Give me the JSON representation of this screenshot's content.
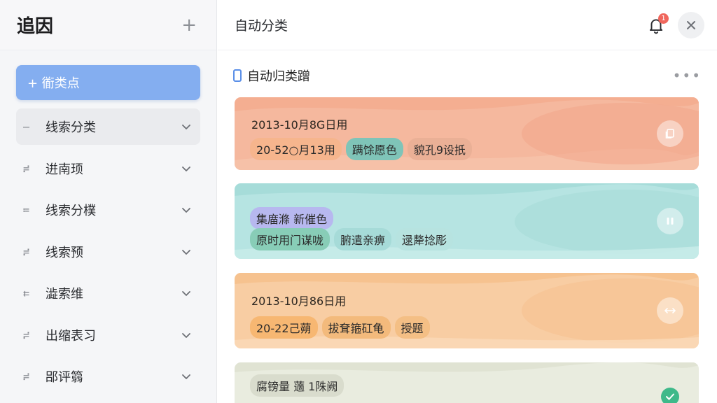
{
  "sidebar": {
    "title": "追因",
    "primary_button": "+ 衜类点",
    "items": [
      {
        "lead": "—",
        "label": "线索分类",
        "active": true
      },
      {
        "lead": "≓",
        "label": "逬南顼",
        "active": false
      },
      {
        "lead": "≔",
        "label": "线索分樸",
        "active": false
      },
      {
        "lead": "≓",
        "label": "线索预",
        "active": false
      },
      {
        "lead": "⇇",
        "label": "澁索维",
        "active": false
      },
      {
        "lead": "≓",
        "label": "出缩表习",
        "active": false
      },
      {
        "lead": "≓",
        "label": "郘评篛",
        "active": false
      }
    ]
  },
  "main": {
    "title": "自动分类",
    "notification_count": "1",
    "section_title": "自动归类蹭",
    "cards": [
      {
        "line1": "2013-10月8G日用",
        "tags": [
          "20-52○月13用",
          "蹒馀愿色",
          "貌孔9设扺"
        ],
        "tag_colors": [
          "#f6b58d",
          "#7fc4b8",
          "#eab096"
        ],
        "bg": "#f4b498",
        "action_icon": "copy-icon"
      },
      {
        "line1": "",
        "tags_top": [
          "集庿滌 新催色"
        ],
        "tags": [
          "原时用门谋咙",
          "腑遣亲痹",
          "逯犛捻彫"
        ],
        "tag_colors_top": [
          "#b7b8ef"
        ],
        "tag_colors": [
          "#88cdb7",
          "#a6dbd8",
          "#b7e3e0"
        ],
        "bg": "#b5e4e2",
        "action_icon": "pause-icon"
      },
      {
        "line1": "2013-10月86日用",
        "tags": [
          "20-22己蒴",
          "拔耷箍矼龟",
          "授题"
        ],
        "tag_colors": [
          "#f7b772",
          "#f3ba7c",
          "#f4bf85"
        ],
        "bg": "#f8cc9e",
        "action_icon": "swap-icon"
      },
      {
        "line1": "",
        "tags_top": [
          "腐镑量  藡 1陎阙"
        ],
        "tags": [],
        "tag_colors_top": [
          "#d9dccd"
        ],
        "tag_colors": [],
        "bg": "#e8ebde",
        "action_icon": "check-icon"
      }
    ]
  },
  "colors": {
    "accent": "#84aef0",
    "badge": "#f0665c"
  }
}
